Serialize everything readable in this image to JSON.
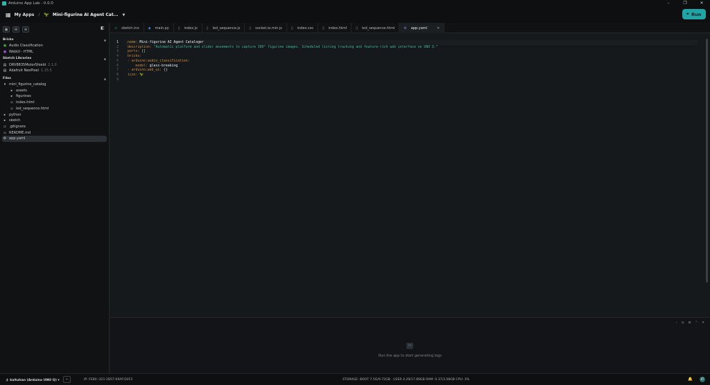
{
  "window": {
    "title": "Arduino App Lab - 0.0.0",
    "minimize": "–",
    "maximize": "❐",
    "close": "✕"
  },
  "topbar": {
    "my_apps": "My Apps",
    "separator": "/",
    "app_icon": "🦖",
    "app_name": "Mini-figurine AI Agent Cat...",
    "run_label": "Run"
  },
  "sidebar": {
    "tool_icons": [
      "folder-icon",
      "folder-plus-icon",
      "file-plus-icon"
    ],
    "bricks_title": "Bricks",
    "bricks": [
      {
        "label": "Audio Classification",
        "icon": "audio-brick-icon",
        "color": "#3f9a3a"
      },
      {
        "label": "WebUI - HTML",
        "icon": "webui-brick-icon",
        "color": "#9a4fd1"
      }
    ],
    "libraries_title": "Sketch Libraries",
    "libraries": [
      {
        "label": "DRV8835MotorShield",
        "version": "2.1.0"
      },
      {
        "label": "Adafruit NeoPixel",
        "version": "1.15.5"
      }
    ],
    "files_title": "Files",
    "files": [
      {
        "label": "mini_figurine_catalog",
        "indent": 0,
        "kind": "folder-open"
      },
      {
        "label": "assets",
        "indent": 1,
        "kind": "folder"
      },
      {
        "label": "figurines",
        "indent": 1,
        "kind": "folder"
      },
      {
        "label": "index.html",
        "indent": 1,
        "kind": "file"
      },
      {
        "label": "led_sequence.html",
        "indent": 1,
        "kind": "file"
      },
      {
        "label": "python",
        "indent": 0,
        "kind": "folder"
      },
      {
        "label": "sketch",
        "indent": 0,
        "kind": "folder"
      },
      {
        "label": ".gitignore",
        "indent": 0,
        "kind": "file"
      },
      {
        "label": "README.md",
        "indent": 0,
        "kind": "file"
      },
      {
        "label": "app.yaml",
        "indent": 0,
        "kind": "yaml",
        "selected": true
      }
    ]
  },
  "tabs": [
    {
      "label": "sketch.ino",
      "icon": "∞"
    },
    {
      "label": "main.py",
      "icon": "◆"
    },
    {
      "label": "index.js",
      "icon": "▯"
    },
    {
      "label": "led_sequence.js",
      "icon": "▯"
    },
    {
      "label": "socket.io.min.js",
      "icon": "▯"
    },
    {
      "label": "index.css",
      "icon": "▯"
    },
    {
      "label": "index.html",
      "icon": "▯"
    },
    {
      "label": "led_sequence.html",
      "icon": "▯"
    },
    {
      "label": "app.yaml",
      "icon": "⚙",
      "active": true
    }
  ],
  "editor": {
    "line_numbers": [
      "1",
      "2",
      "3",
      "4",
      "5",
      "6",
      "7",
      "8",
      "9"
    ],
    "lines": [
      {
        "key": "name",
        "rest": " Mini-figurine AI Agent Cataloger"
      },
      {
        "key": "description",
        "rest": " \"Automatic platform and slider movements to capture 360° figurine images. Scheduled listing tracking and feature-rich web interface on UNO Q.\""
      },
      {
        "key": "ports",
        "rest": " []"
      },
      {
        "key": "bricks",
        "rest": ""
      },
      {
        "key": "- arduino:audio_classification",
        "rest": ""
      },
      {
        "key": "    model",
        "rest": " glass-breaking"
      },
      {
        "key": "- arduino:web_ui",
        "rest": " {}"
      },
      {
        "key": "icon",
        "rest": " 🦖"
      },
      {
        "key": "",
        "rest": ""
      }
    ]
  },
  "logs": {
    "empty_text": "Run the app to start generating logs",
    "tool_labels": [
      "–",
      "◷",
      "⊟",
      "⌃",
      "✕"
    ]
  },
  "status": {
    "board": "kaituhan (Arduino UNO Q)",
    "ip": "IP: FE80::321:1B57:69AF:D2F2",
    "stats": "STORAGE: BOOT 7.5G/9.72GB · USER 4.29/17.89GB   RAM: 0.37/3.58GB   CPU: 3%",
    "avatar": "KT"
  }
}
